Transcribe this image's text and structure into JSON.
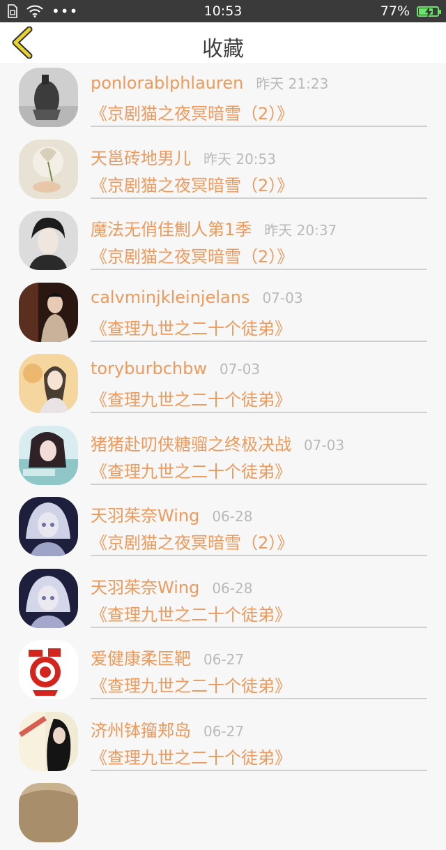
{
  "status_bar": {
    "time": "10:53",
    "battery": "77%",
    "battery_level": 0.77,
    "more_dots": "•••",
    "icons": [
      "sim-card-icon",
      "wifi-icon",
      "battery-charging-icon"
    ]
  },
  "header": {
    "title": "收藏",
    "back_icon": "chevron-left-icon"
  },
  "colors": {
    "accent": "#ee9a5c",
    "muted": "#b9b9b9",
    "back_icon_fill": "#e8d233",
    "status_bg": "#3a3a3a"
  },
  "favorites": [
    {
      "name": "ponlorablphlauren",
      "time": "昨天 21:23",
      "work": "《京剧猫之夜冥暗雪（2）》"
    },
    {
      "name": "天邕砖地男儿",
      "time": "昨天 20:53",
      "work": "《京剧猫之夜冥暗雪（2）》"
    },
    {
      "name": "魔法无俏佳劁人第1季",
      "time": "昨天 20:37",
      "work": "《京剧猫之夜冥暗雪（2）》"
    },
    {
      "name": "calvminjkleinjelans",
      "time": "07-03",
      "work": "《查理九世之二十个徒弟》"
    },
    {
      "name": "toryburbchbw",
      "time": "07-03",
      "work": "《查理九世之二十个徒弟》"
    },
    {
      "name": "猪猪赴叨侠糖骝之终极决战",
      "time": "07-03",
      "work": "《查理九世之二十个徒弟》"
    },
    {
      "name": "天羽茱奈Wing",
      "time": "06-28",
      "work": "《京剧猫之夜冥暗雪（2）》"
    },
    {
      "name": "天羽茱奈Wing",
      "time": "06-28",
      "work": "《查理九世之二十个徒弟》"
    },
    {
      "name": "爱健康柔匡靶",
      "time": "06-27",
      "work": "《查理九世之二十个徒弟》"
    },
    {
      "name": "济州钵籀郏岛",
      "time": "06-27",
      "work": "《查理九世之二十个徒弟》"
    },
    {
      "name": "",
      "time": "",
      "work": ""
    }
  ]
}
